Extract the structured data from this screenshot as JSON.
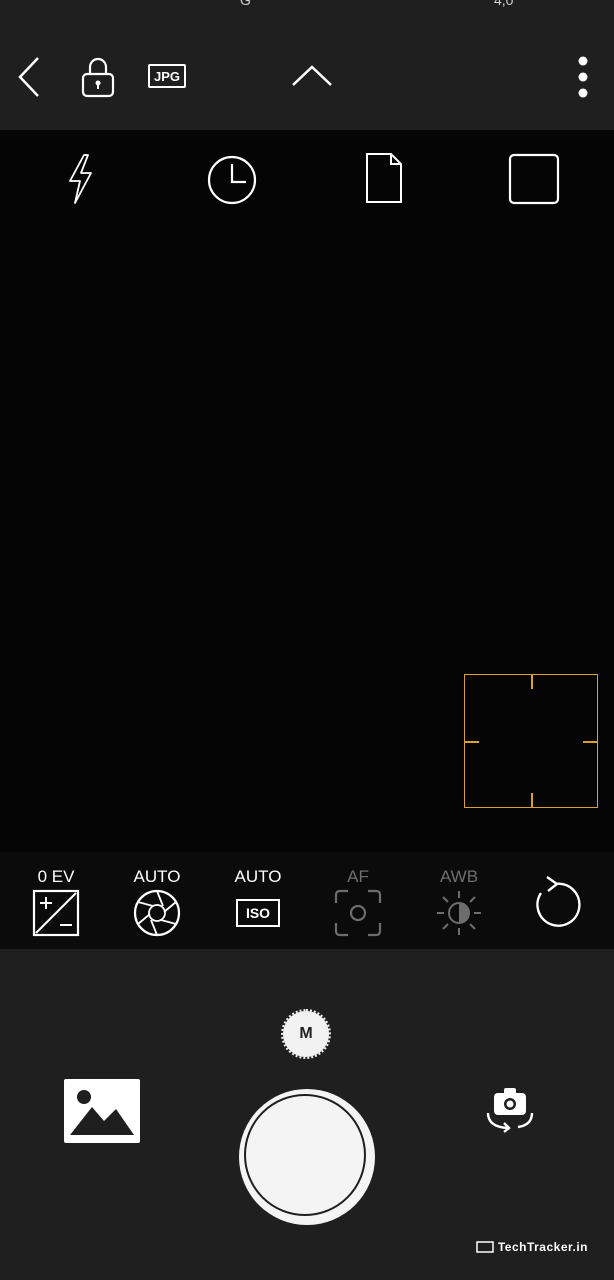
{
  "status_bar": {
    "fragment_left": "G",
    "fragment_right": "4,0"
  },
  "top_bar": {
    "icons": [
      "back-icon",
      "lock-icon",
      "jpg-format-icon",
      "chevron-up-icon",
      "more-vert-icon"
    ],
    "format_label": "JPG"
  },
  "quick_settings": {
    "icons": [
      "flash-icon",
      "timer-icon",
      "document-icon",
      "aspect-ratio-icon"
    ]
  },
  "controls": {
    "items": [
      {
        "label": "0 EV",
        "icon": "exposure-icon",
        "enabled": true
      },
      {
        "label": "AUTO",
        "icon": "aperture-icon",
        "enabled": true
      },
      {
        "label": "AUTO",
        "icon": "iso-icon",
        "icon_text": "ISO",
        "enabled": true
      },
      {
        "label": "AF",
        "icon": "focus-icon",
        "enabled": false
      },
      {
        "label": "AWB",
        "icon": "white-balance-icon",
        "enabled": false
      }
    ],
    "reset_icon": "reset-icon"
  },
  "bottom": {
    "mode_label": "M",
    "gallery_icon": "gallery-icon",
    "shutter": "shutter-button",
    "flip_icon": "flip-camera-icon"
  },
  "watermark": {
    "text": "TechTracker.in"
  },
  "colors": {
    "accent_focus": "#d9a32a",
    "bar_bg": "#1f1f1f",
    "viewfinder_bg": "#050505"
  }
}
